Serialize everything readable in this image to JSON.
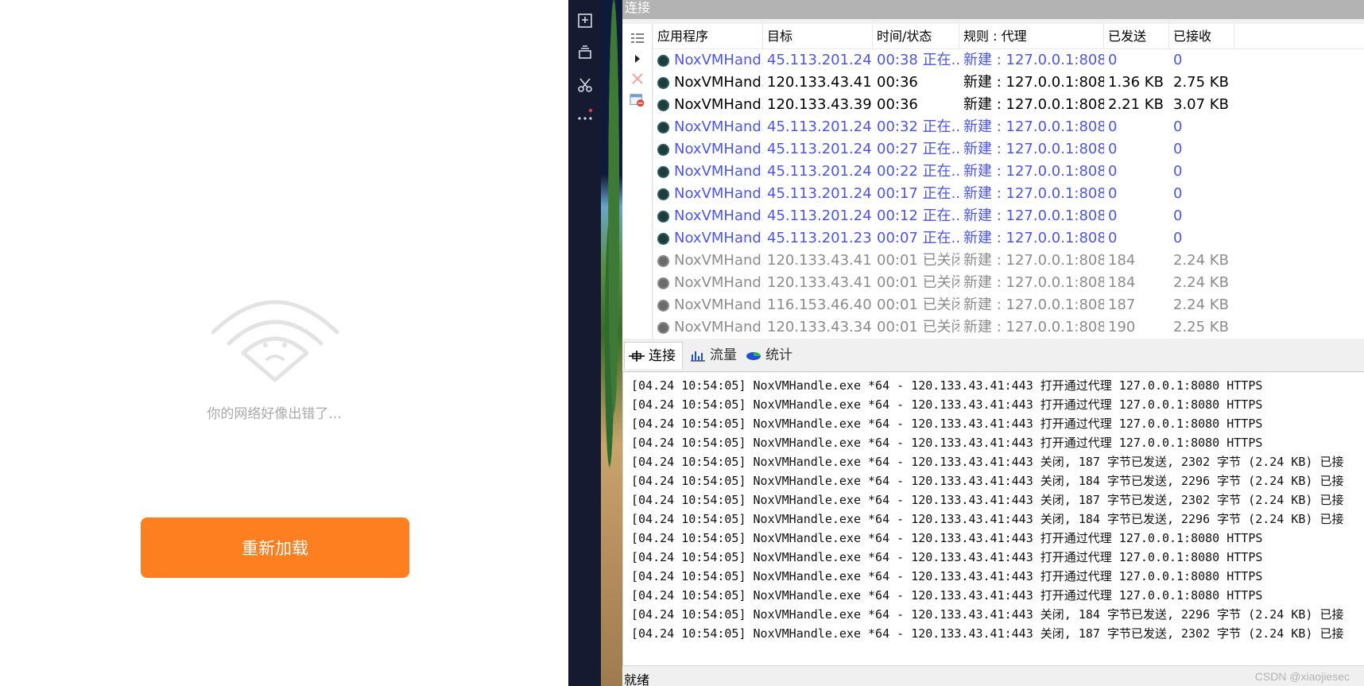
{
  "left": {
    "error_text": "你的网络好像出错了...",
    "reload_label": "重新加载",
    "accent_color": "#fd7f1f"
  },
  "toolbar": {
    "icons": [
      "apk-install-icon",
      "multi-window-icon",
      "scissors-icon",
      "more-icon"
    ]
  },
  "proxifier": {
    "connections_title": "连接",
    "columns": [
      "应用程序",
      "目标",
      "时间/状态",
      "规则 : 代理",
      "已发送",
      "已接收"
    ],
    "rows": [
      {
        "app": "NoxVMHand...",
        "target": "45.113.201.24...",
        "time": "00:38 正在...",
        "rule": "新建 : 127.0.0.1:8080...",
        "sent": "0",
        "recv": "0",
        "state": "active"
      },
      {
        "app": "NoxVMHand...",
        "target": "120.133.43.41:...",
        "time": "00:36",
        "rule": "新建 : 127.0.0.1:8080...",
        "sent": "1.36 KB",
        "recv": "2.75 KB",
        "state": "open"
      },
      {
        "app": "NoxVMHand...",
        "target": "120.133.43.39:...",
        "time": "00:36",
        "rule": "新建 : 127.0.0.1:8080...",
        "sent": "2.21 KB",
        "recv": "3.07 KB",
        "state": "open"
      },
      {
        "app": "NoxVMHand...",
        "target": "45.113.201.24...",
        "time": "00:32 正在...",
        "rule": "新建 : 127.0.0.1:8080...",
        "sent": "0",
        "recv": "0",
        "state": "active"
      },
      {
        "app": "NoxVMHand...",
        "target": "45.113.201.24...",
        "time": "00:27 正在...",
        "rule": "新建 : 127.0.0.1:8080...",
        "sent": "0",
        "recv": "0",
        "state": "active"
      },
      {
        "app": "NoxVMHand...",
        "target": "45.113.201.24...",
        "time": "00:22 正在...",
        "rule": "新建 : 127.0.0.1:8080...",
        "sent": "0",
        "recv": "0",
        "state": "active"
      },
      {
        "app": "NoxVMHand...",
        "target": "45.113.201.24...",
        "time": "00:17 正在...",
        "rule": "新建 : 127.0.0.1:8080...",
        "sent": "0",
        "recv": "0",
        "state": "active"
      },
      {
        "app": "NoxVMHand...",
        "target": "45.113.201.24...",
        "time": "00:12 正在...",
        "rule": "新建 : 127.0.0.1:8080...",
        "sent": "0",
        "recv": "0",
        "state": "active"
      },
      {
        "app": "NoxVMHand...",
        "target": "45.113.201.23...",
        "time": "00:07 正在...",
        "rule": "新建 : 127.0.0.1:8080...",
        "sent": "0",
        "recv": "0",
        "state": "active"
      },
      {
        "app": "NoxVMHand...",
        "target": "120.133.43.41:...",
        "time": "00:01 已关闭",
        "rule": "新建 : 127.0.0.1:8080...",
        "sent": "184",
        "recv": "2.24 KB",
        "state": "closed"
      },
      {
        "app": "NoxVMHand...",
        "target": "120.133.43.41:...",
        "time": "00:01 已关闭",
        "rule": "新建 : 127.0.0.1:8080...",
        "sent": "184",
        "recv": "2.24 KB",
        "state": "closed"
      },
      {
        "app": "NoxVMHand...",
        "target": "116.153.46.40:...",
        "time": "00:01 已关闭",
        "rule": "新建 : 127.0.0.1:8080...",
        "sent": "187",
        "recv": "2.24 KB",
        "state": "closed"
      },
      {
        "app": "NoxVMHand...",
        "target": "120.133.43.34:...",
        "time": "00:01 已关闭",
        "rule": "新建 : 127.0.0.1:8080...",
        "sent": "190",
        "recv": "2.25 KB",
        "state": "closed"
      }
    ],
    "tabs": [
      {
        "label": "连接",
        "icon": "connection-icon",
        "active": true
      },
      {
        "label": "流量",
        "icon": "traffic-chart-icon",
        "active": false
      },
      {
        "label": "统计",
        "icon": "pie-chart-icon",
        "active": false
      }
    ],
    "log": [
      "[04.24 10:54:05] NoxVMHandle.exe *64 - 120.133.43.41:443 打开通过代理 127.0.0.1:8080 HTTPS",
      "[04.24 10:54:05] NoxVMHandle.exe *64 - 120.133.43.41:443 打开通过代理 127.0.0.1:8080 HTTPS",
      "[04.24 10:54:05] NoxVMHandle.exe *64 - 120.133.43.41:443 打开通过代理 127.0.0.1:8080 HTTPS",
      "[04.24 10:54:05] NoxVMHandle.exe *64 - 120.133.43.41:443 打开通过代理 127.0.0.1:8080 HTTPS",
      "[04.24 10:54:05] NoxVMHandle.exe *64 - 120.133.43.41:443 关闭, 187 字节已发送, 2302 字节 (2.24 KB) 已接",
      "[04.24 10:54:05] NoxVMHandle.exe *64 - 120.133.43.41:443 关闭, 184 字节已发送, 2296 字节 (2.24 KB) 已接",
      "[04.24 10:54:05] NoxVMHandle.exe *64 - 120.133.43.41:443 关闭, 187 字节已发送, 2302 字节 (2.24 KB) 已接",
      "[04.24 10:54:05] NoxVMHandle.exe *64 - 120.133.43.41:443 关闭, 184 字节已发送, 2296 字节 (2.24 KB) 已接",
      "[04.24 10:54:05] NoxVMHandle.exe *64 - 120.133.43.41:443 打开通过代理 127.0.0.1:8080 HTTPS",
      "[04.24 10:54:05] NoxVMHandle.exe *64 - 120.133.43.41:443 打开通过代理 127.0.0.1:8080 HTTPS",
      "[04.24 10:54:05] NoxVMHandle.exe *64 - 120.133.43.41:443 打开通过代理 127.0.0.1:8080 HTTPS",
      "[04.24 10:54:05] NoxVMHandle.exe *64 - 120.133.43.41:443 打开通过代理 127.0.0.1:8080 HTTPS",
      "[04.24 10:54:05] NoxVMHandle.exe *64 - 120.133.43.41:443 关闭, 184 字节已发送, 2296 字节 (2.24 KB) 已接",
      "[04.24 10:54:05] NoxVMHandle.exe *64 - 120.133.43.41:443 关闭, 187 字节已发送, 2302 字节 (2.24 KB) 已接"
    ],
    "status": "就绪",
    "colors": {
      "active": "#4d55e6",
      "open": "#000000",
      "closed": "#8c8c8c"
    }
  },
  "watermark": "CSDN @xiaojiesec"
}
